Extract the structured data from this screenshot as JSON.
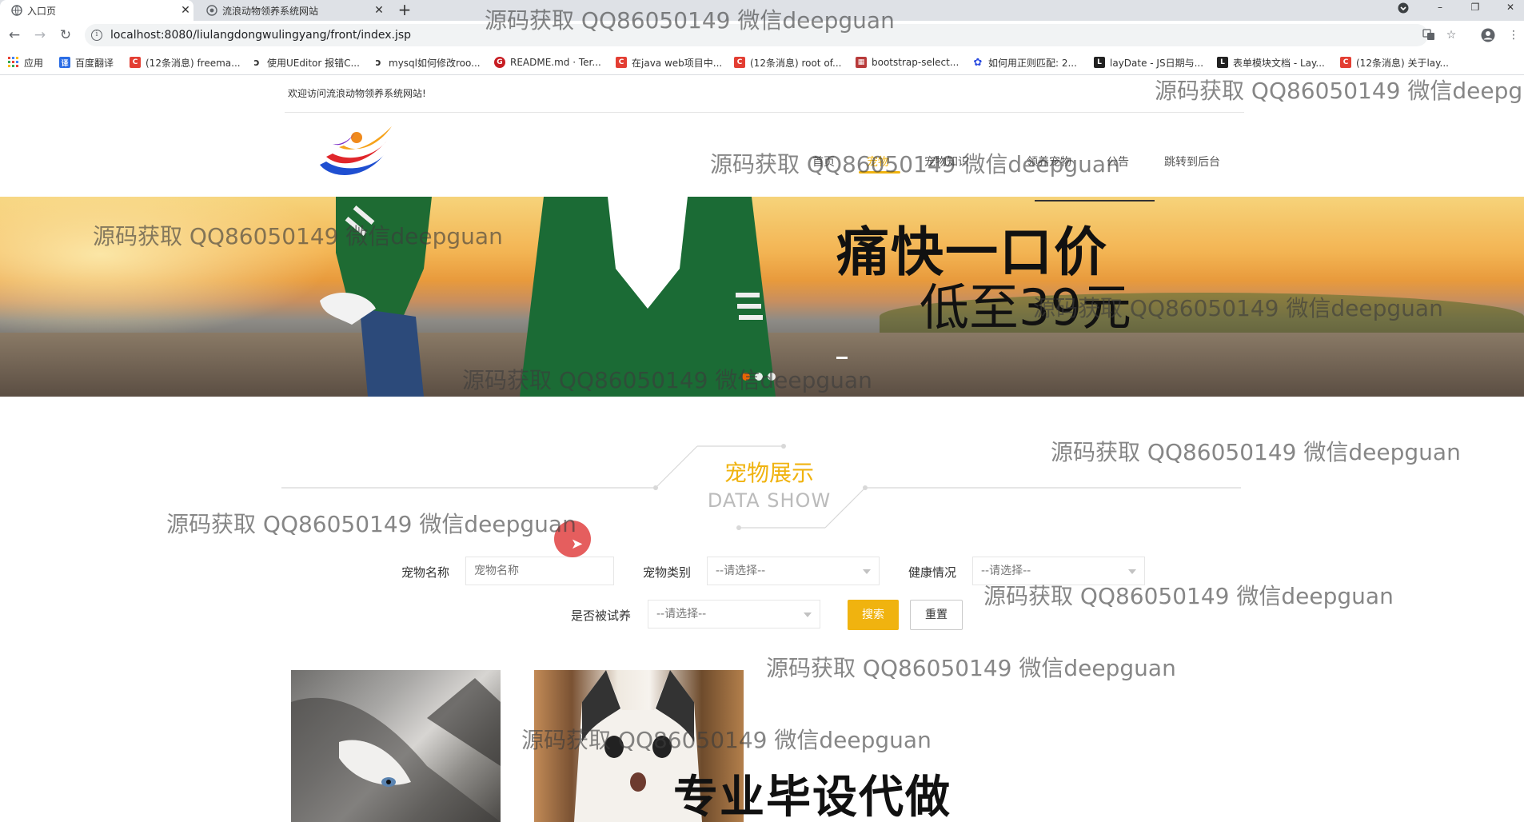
{
  "browser": {
    "tabs": [
      {
        "title": "入口页",
        "icon": "globe-icon",
        "active": true
      },
      {
        "title": "流浪动物领养系统网站",
        "icon": "site-icon",
        "active": false
      }
    ],
    "new_tab": "+",
    "window_controls": {
      "menu": "⌄",
      "minimize": "–",
      "restore": "❐",
      "close": "✕"
    },
    "back": "←",
    "forward": "→",
    "reload": "↻",
    "url": "localhost:8080/liulangdongwulingyang/front/index.jsp",
    "bookmarks": [
      {
        "label": "应用",
        "icon": "apps-icon"
      },
      {
        "label": "百度翻译",
        "icon": "translate-icon"
      },
      {
        "label": "(12条消息) freema...",
        "icon": "csdn-icon"
      },
      {
        "label": "使用UEditor 报错C...",
        "icon": "bookmark-icon"
      },
      {
        "label": "mysql如何修改roo...",
        "icon": "bookmark-icon"
      },
      {
        "label": "README.md · Ter...",
        "icon": "gitee-icon"
      },
      {
        "label": "在java web项目中...",
        "icon": "csdn-icon"
      },
      {
        "label": "(12条消息) root of...",
        "icon": "csdn-icon"
      },
      {
        "label": "bootstrap-select...",
        "icon": "bookmark-icon"
      },
      {
        "label": "如何用正则匹配: 2...",
        "icon": "baidu-icon"
      },
      {
        "label": "layDate - JS日期与...",
        "icon": "layui-icon"
      },
      {
        "label": "表单模块文档 - Lay...",
        "icon": "layui-icon"
      },
      {
        "label": "(12条消息) 关于lay...",
        "icon": "csdn-icon"
      }
    ]
  },
  "page": {
    "welcome": "欢迎访问流浪动物领养系统网站!",
    "nav": {
      "home": "首页",
      "pets": "宠物",
      "knowledge": "宠物知识",
      "adopt": "领养宠物",
      "notice": "公告",
      "admin": "跳转到后台"
    },
    "banner": {
      "headline": "痛快一口价",
      "price": "低至39元"
    },
    "section": {
      "title": "宠物展示",
      "subtitle": "DATA SHOW"
    },
    "search": {
      "name_label": "宠物名称",
      "name_placeholder": "宠物名称",
      "type_label": "宠物类别",
      "type_value": "--请选择--",
      "health_label": "健康情况",
      "health_value": "--请选择--",
      "trial_label": "是否被试养",
      "trial_value": "--请选择--",
      "search_button": "搜索",
      "reset_button": "重置"
    }
  },
  "overlay": {
    "watermark": "源码获取 QQ86050149 微信deepguan",
    "promo": "专业毕设代做"
  },
  "colors": {
    "accent": "#f0b30f",
    "cursor": "#dc2828"
  }
}
